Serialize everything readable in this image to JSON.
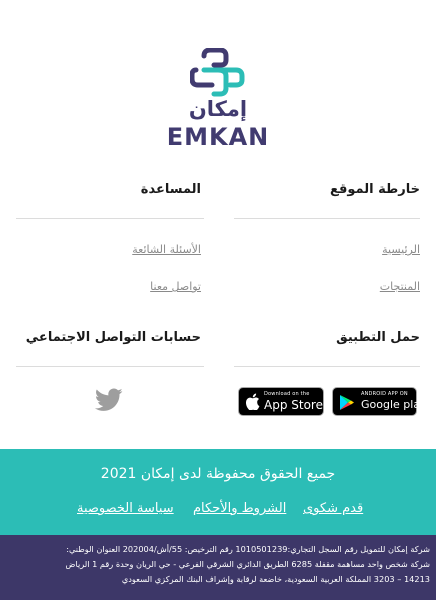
{
  "brand": {
    "logo_ar": "إمكان",
    "logo_en": "EMKAN",
    "colors": {
      "purple": "#413b70",
      "teal": "#2cbdb6",
      "dark_band": "#3d3768"
    }
  },
  "sitemap": {
    "heading": "خارطة الموقع",
    "links": [
      "الرئيسية",
      "المنتجات"
    ]
  },
  "help": {
    "heading": "المساعدة",
    "links": [
      "الأسئلة الشائعة",
      "تواصل معنا"
    ]
  },
  "app": {
    "heading": "حمل التطبيق",
    "google_small": "ANDROID APP ON",
    "google_big": "Google play",
    "apple_small": "Download on the",
    "apple_big": "App Store"
  },
  "social": {
    "heading": "حسابات التواصل الاجتماعي",
    "icons": [
      "twitter-icon"
    ]
  },
  "band": {
    "copyright": "جميع الحقوق محفوظة لدى إمكان 2021",
    "links": [
      "قدم شكوى",
      "الشروط والأحكام",
      "سياسة الخصوصية"
    ]
  },
  "legal": {
    "line1": "شركة إمكان للتمويل رقم السجل التجاري:1010501239 رقم الترخيص: 55/أش/202004 العنوان الوطني:",
    "line2": "شركة شخص واحد مساهمة مقفلة 6285 الطريق الدائري الشرقي الفرعي - حي الريان وحدة رقم 1 الرياض",
    "line3": "14213 – 3203 المملكة العربية السعودية، خاضعة لرقابة وإشراف البنك المركزي السعودي"
  }
}
